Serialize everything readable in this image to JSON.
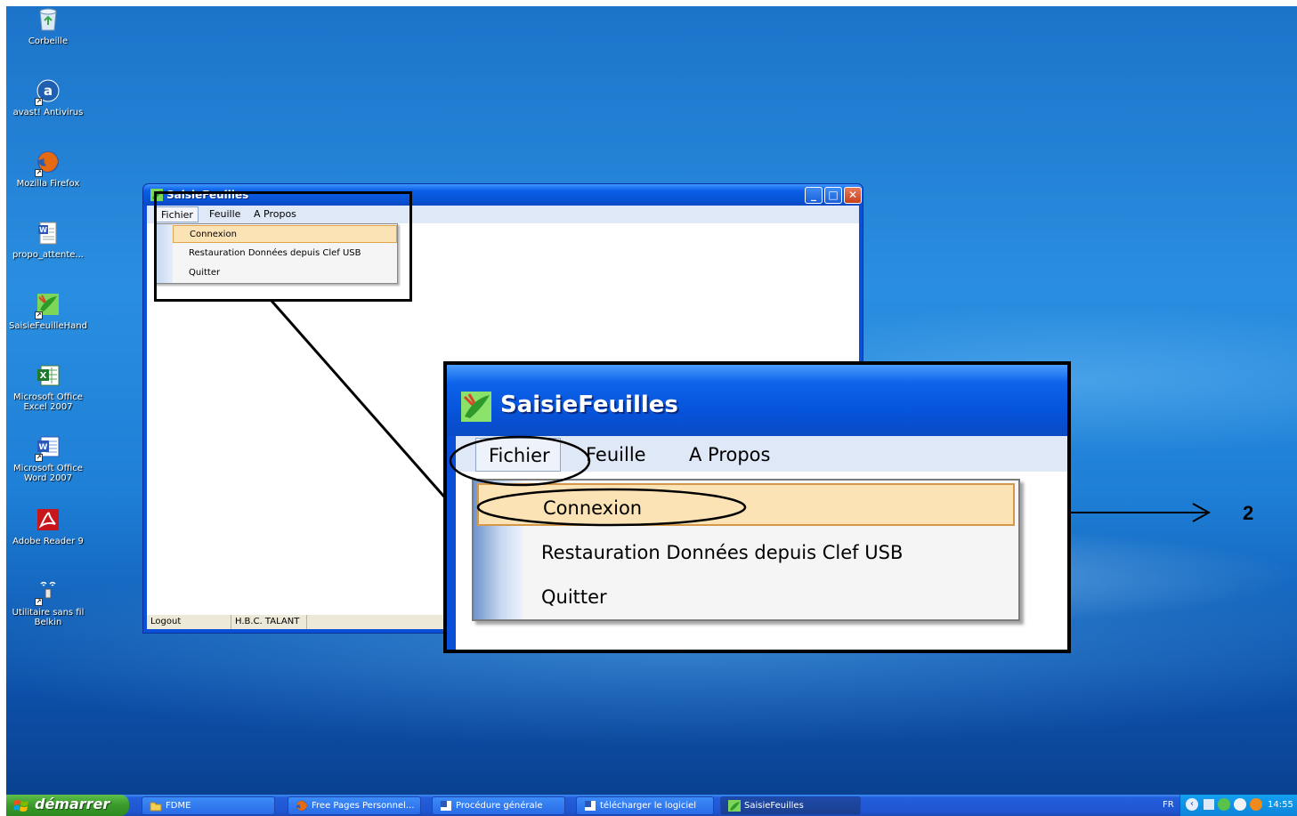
{
  "desktop": {
    "icons": [
      {
        "label": "Corbeille",
        "icon": "recycle-bin-icon"
      },
      {
        "label": "avast! Antivirus",
        "icon": "avast-icon"
      },
      {
        "label": "Mozilla Firefox",
        "icon": "firefox-icon"
      },
      {
        "label": "propo_attente...",
        "icon": "word-document-icon"
      },
      {
        "label": "SaisieFeuilleHand",
        "icon": "saisie-app-icon"
      },
      {
        "label": "Microsoft Office Excel 2007",
        "icon": "excel-icon"
      },
      {
        "label": "Microsoft Office Word 2007",
        "icon": "word-icon"
      },
      {
        "label": "Adobe Reader 9",
        "icon": "adobe-reader-icon"
      },
      {
        "label": "Utilitaire sans fil Belkin",
        "icon": "belkin-wireless-icon"
      }
    ]
  },
  "app": {
    "title": "SaisieFeuilles",
    "menu": {
      "fichier": "Fichier",
      "feuille": "Feuille",
      "apropos": "A Propos"
    },
    "dropdown": [
      "Connexion",
      "Restauration Données depuis Clef USB",
      "Quitter"
    ],
    "status": {
      "left": "Logout",
      "right": "H.B.C. TALANT"
    }
  },
  "annotation": {
    "number": "2"
  },
  "taskbar": {
    "start_label": "démarrer",
    "tasks": [
      {
        "label": "FDME",
        "icon": "folder-icon"
      },
      {
        "label": "Free Pages Personnel...",
        "icon": "firefox-icon"
      },
      {
        "label": "Procédure générale",
        "icon": "word-icon"
      },
      {
        "label": "télécharger le logiciel",
        "icon": "word-icon"
      },
      {
        "label": "SaisieFeuilles",
        "icon": "saisie-app-icon"
      }
    ],
    "tray": {
      "lang": "FR",
      "time": "14:55"
    }
  },
  "colors": {
    "titlebar": "#0754d8",
    "menu_highlight": "#fce3b5",
    "taskbar": "#245edb",
    "start": "#3a9a2a"
  }
}
